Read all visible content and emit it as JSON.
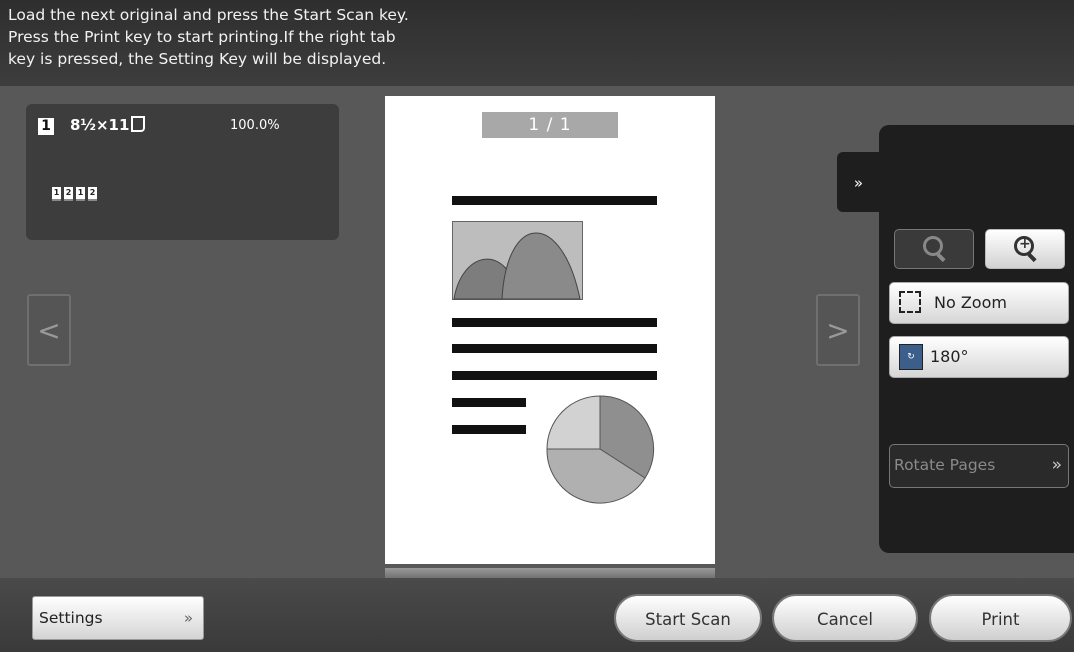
{
  "header": {
    "message_lines": [
      "Load the next original and press the Start Scan key.",
      "Press the Print key to start printing.If the right tab",
      "key is pressed, the Setting Key will be displayed."
    ]
  },
  "info_panel": {
    "copy_count": "1",
    "paper_size": "8½×11",
    "zoom": "100.0%",
    "page_icons": [
      "1",
      "2",
      "1",
      "2"
    ]
  },
  "preview": {
    "page_counter": "1  /  1",
    "prev_arrow": "<",
    "next_arrow": ">"
  },
  "side_panel": {
    "tab_icon": "»",
    "zoom_out_icon": "zoom-out-icon",
    "zoom_in_icon": "zoom-in-icon",
    "no_zoom_label": "No Zoom",
    "rotate_label": "180°",
    "rotate_pages_label": "Rotate Pages",
    "rotate_pages_chevron": "»"
  },
  "footer": {
    "settings_label": "Settings",
    "settings_chevron": "»",
    "start_scan_label": "Start Scan",
    "cancel_label": "Cancel",
    "print_label": "Print"
  }
}
